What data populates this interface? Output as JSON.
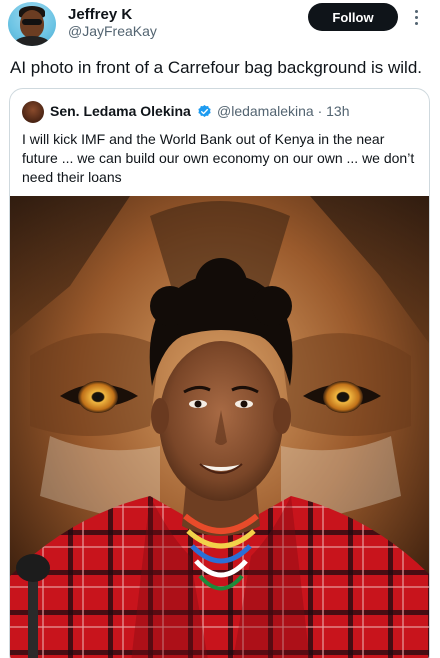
{
  "author": {
    "name": "Jeffrey K",
    "handle": "@JayFreaKay",
    "avatar_icon": "profile-avatar"
  },
  "follow_label": "Follow",
  "more_icon": "more-vertical-icon",
  "tweet_text": "AI photo in front of a Carrefour bag background is wild.",
  "quoted": {
    "name": "Sen. Ledama Olekina",
    "verified_icon": "verified-badge-icon",
    "handle_time": "@ledamalekina · 13h",
    "text": "I will kick IMF and the  World Bank out of Kenya in the near future ... we can build our own economy on our own ... we don’t need their loans",
    "media": "photo of a man in red shuka with a lion face behind him"
  },
  "colors": {
    "follow_bg": "#0f1419",
    "verified": "#1d9bf0",
    "shuka_red": "#c8141c",
    "lion_fur": "#b8703a"
  }
}
